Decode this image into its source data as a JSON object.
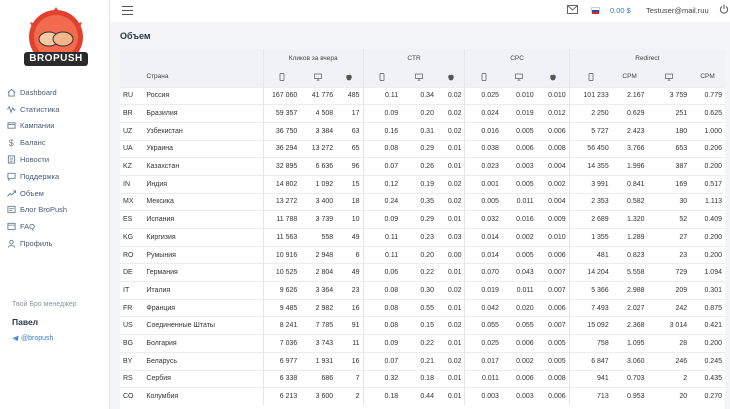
{
  "brand": {
    "logo_text": "BROPUSH"
  },
  "topbar": {
    "balance": "0.00 $",
    "user_email": "Testuser@mail.ruu"
  },
  "sidebar": {
    "items": [
      {
        "label": "Dashboard",
        "icon": "home-icon"
      },
      {
        "label": "Статистика",
        "icon": "wave-icon"
      },
      {
        "label": "Кампании",
        "icon": "campaign-icon"
      },
      {
        "label": "Баланс",
        "icon": "dollar-icon"
      },
      {
        "label": "Новости",
        "icon": "news-icon"
      },
      {
        "label": "Поддержка",
        "icon": "chat-icon"
      },
      {
        "label": "Объем",
        "icon": "trend-icon"
      },
      {
        "label": "Блог BroPush",
        "icon": "blog-icon"
      },
      {
        "label": "FAQ",
        "icon": "faq-icon"
      },
      {
        "label": "Профиль",
        "icon": "user-icon"
      }
    ],
    "manager_label": "Твой Бро менеджер",
    "manager_name": "Павел",
    "manager_telegram": "@bropush"
  },
  "page": {
    "title": "Объем"
  },
  "table": {
    "group_headers": {
      "clicks": "Кликов за вчера",
      "ctr": "CTR",
      "cpc": "CPC",
      "redirect": "Redirect"
    },
    "country_header": "Страна",
    "cpm_label": "CPM",
    "rows": [
      {
        "code": "RU",
        "country": "Россия",
        "v": [
          "167 060",
          "41 776",
          "485",
          "0.11",
          "0.34",
          "0.02",
          "0.025",
          "0.010",
          "0.010",
          "101 233",
          "2.167",
          "3 759",
          "0.779"
        ]
      },
      {
        "code": "BR",
        "country": "Бразилия",
        "v": [
          "59 357",
          "4 508",
          "17",
          "0.09",
          "0.20",
          "0.02",
          "0.024",
          "0.019",
          "0.012",
          "2 250",
          "0.629",
          "251",
          "0.625"
        ]
      },
      {
        "code": "UZ",
        "country": "Узбекистан",
        "v": [
          "36 750",
          "3 384",
          "63",
          "0.16",
          "0.31",
          "0.02",
          "0.016",
          "0.005",
          "0.006",
          "5 727",
          "2.423",
          "180",
          "1.000"
        ]
      },
      {
        "code": "UA",
        "country": "Украина",
        "v": [
          "36 294",
          "13 272",
          "65",
          "0.08",
          "0.29",
          "0.01",
          "0.038",
          "0.006",
          "0.008",
          "56 450",
          "3.766",
          "653",
          "0.206"
        ]
      },
      {
        "code": "KZ",
        "country": "Казахстан",
        "v": [
          "32 895",
          "6 636",
          "96",
          "0.07",
          "0.26",
          "0.01",
          "0.023",
          "0.003",
          "0.004",
          "14 355",
          "1.996",
          "387",
          "0.200"
        ]
      },
      {
        "code": "IN",
        "country": "Индия",
        "v": [
          "14 802",
          "1 092",
          "15",
          "0.12",
          "0.19",
          "0.02",
          "0.001",
          "0.005",
          "0.002",
          "3 991",
          "0.841",
          "169",
          "0.517"
        ]
      },
      {
        "code": "MX",
        "country": "Мексика",
        "v": [
          "13 272",
          "3 400",
          "18",
          "0.24",
          "0.35",
          "0.02",
          "0.005",
          "0.011",
          "0.004",
          "2 353",
          "0.582",
          "30",
          "1.113"
        ]
      },
      {
        "code": "ES",
        "country": "Испания",
        "v": [
          "11 788",
          "3 739",
          "10",
          "0.09",
          "0.29",
          "0.01",
          "0.032",
          "0.016",
          "0.009",
          "2 689",
          "1.320",
          "52",
          "0.409"
        ]
      },
      {
        "code": "KG",
        "country": "Киргизия",
        "v": [
          "11 563",
          "558",
          "49",
          "0.11",
          "0.23",
          "0.03",
          "0.014",
          "0.002",
          "0.010",
          "1 355",
          "1.289",
          "27",
          "0.200"
        ]
      },
      {
        "code": "RO",
        "country": "Румыния",
        "v": [
          "10 916",
          "2 948",
          "6",
          "0.11",
          "0.20",
          "0.00",
          "0.014",
          "0.005",
          "0.006",
          "481",
          "0.823",
          "23",
          "0.200"
        ]
      },
      {
        "code": "DE",
        "country": "Германия",
        "v": [
          "10 525",
          "2 804",
          "49",
          "0.06",
          "0.22",
          "0.01",
          "0.070",
          "0.043",
          "0.007",
          "14 204",
          "5.558",
          "729",
          "1.094"
        ]
      },
      {
        "code": "IT",
        "country": "Италия",
        "v": [
          "9 626",
          "3 364",
          "23",
          "0.08",
          "0.30",
          "0.02",
          "0.019",
          "0.011",
          "0.007",
          "5 366",
          "2.988",
          "209",
          "0.301"
        ]
      },
      {
        "code": "FR",
        "country": "Франция",
        "v": [
          "9 485",
          "2 982",
          "16",
          "0.08",
          "0.55",
          "0.01",
          "0.042",
          "0.020",
          "0.006",
          "7 493",
          "2.027",
          "242",
          "0.875"
        ]
      },
      {
        "code": "US",
        "country": "Соединенные Штаты",
        "v": [
          "8 241",
          "7 785",
          "91",
          "0.08",
          "0.15",
          "0.02",
          "0.055",
          "0.055",
          "0.007",
          "15 092",
          "2.368",
          "3 014",
          "0.421"
        ]
      },
      {
        "code": "BG",
        "country": "Болгария",
        "v": [
          "7 036",
          "3 743",
          "11",
          "0.09",
          "0.22",
          "0.01",
          "0.025",
          "0.006",
          "0.005",
          "758",
          "1.095",
          "28",
          "0.200"
        ]
      },
      {
        "code": "BY",
        "country": "Беларусь",
        "v": [
          "6 977",
          "1 931",
          "16",
          "0.07",
          "0.21",
          "0.02",
          "0.017",
          "0.002",
          "0.005",
          "6 847",
          "3.060",
          "246",
          "0.245"
        ]
      },
      {
        "code": "RS",
        "country": "Сербия",
        "v": [
          "6 338",
          "686",
          "7",
          "0.32",
          "0.18",
          "0.01",
          "0.011",
          "0.006",
          "0.008",
          "941",
          "0.703",
          "2",
          "0.435"
        ]
      },
      {
        "code": "CO",
        "country": "Колумбия",
        "v": [
          "6 213",
          "3 600",
          "2",
          "0.18",
          "0.44",
          "0.01",
          "0.003",
          "0.003",
          "0.006",
          "713",
          "0.953",
          "20",
          "0.270"
        ]
      }
    ]
  }
}
